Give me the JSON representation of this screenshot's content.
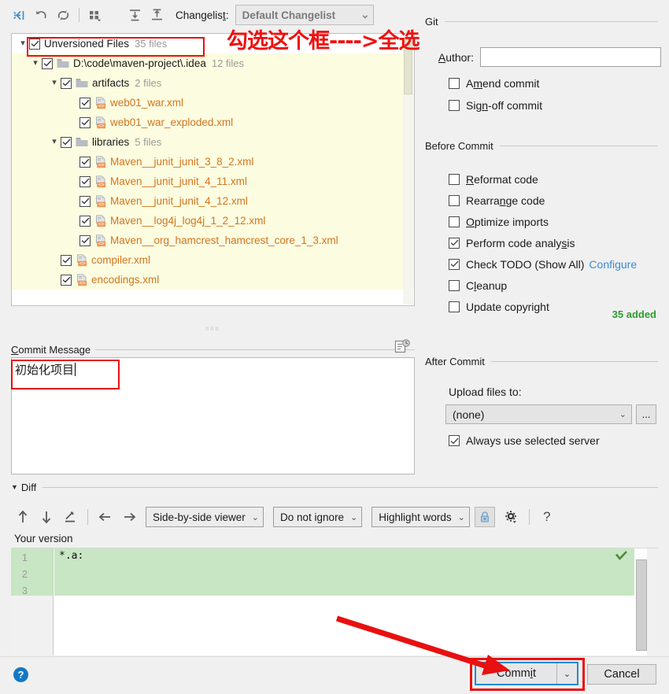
{
  "toolbar": {
    "icons": [
      {
        "name": "shelve-silently-icon",
        "glyph": "⇥"
      },
      {
        "name": "rollback-icon",
        "glyph": "↺"
      },
      {
        "name": "refresh-icon",
        "glyph": "⟳"
      },
      {
        "name": "group-by-icon",
        "glyph": "▦"
      },
      {
        "name": "expand-all-icon",
        "glyph": "⤒"
      },
      {
        "name": "collapse-all-icon",
        "glyph": "⤓"
      }
    ],
    "changelist_label": "Changelist:",
    "changelist_label_mnemonic": "t",
    "changelist_value": "Default Changelist",
    "chevron": "⌄"
  },
  "annotations": {
    "red_text": "勾选这个框---->全选",
    "boxes": [
      "unversioned-files-row",
      "commit-message-text",
      "commit-button"
    ],
    "arrow_color": "#e81010"
  },
  "tree": {
    "root": {
      "label": "Unversioned Files",
      "count": "35 files",
      "checked": true,
      "expanded": true
    },
    "nodes": [
      {
        "depth": 1,
        "type": "folder",
        "label": "D:\\code\\maven-project\\.idea",
        "count": "12 files",
        "checked": true,
        "expanded": true
      },
      {
        "depth": 2,
        "type": "folder",
        "label": "artifacts",
        "count": "2 files",
        "checked": true,
        "expanded": true
      },
      {
        "depth": 3,
        "type": "xml",
        "label": "web01_war.xml",
        "count": "",
        "checked": true
      },
      {
        "depth": 3,
        "type": "xml",
        "label": "web01_war_exploded.xml",
        "count": "",
        "checked": true
      },
      {
        "depth": 2,
        "type": "folder",
        "label": "libraries",
        "count": "5 files",
        "checked": true,
        "expanded": true
      },
      {
        "depth": 3,
        "type": "xml",
        "label": "Maven__junit_junit_3_8_2.xml",
        "count": "",
        "checked": true
      },
      {
        "depth": 3,
        "type": "xml",
        "label": "Maven__junit_junit_4_11.xml",
        "count": "",
        "checked": true
      },
      {
        "depth": 3,
        "type": "xml",
        "label": "Maven__junit_junit_4_12.xml",
        "count": "",
        "checked": true
      },
      {
        "depth": 3,
        "type": "xml",
        "label": "Maven__log4j_log4j_1_2_12.xml",
        "count": "",
        "checked": true
      },
      {
        "depth": 3,
        "type": "xml",
        "label": "Maven__org_hamcrest_hamcrest_core_1_3.xml",
        "count": "",
        "checked": true
      },
      {
        "depth": 2,
        "type": "xml",
        "label": "compiler.xml",
        "count": "",
        "checked": true
      },
      {
        "depth": 2,
        "type": "xml",
        "label": "encodings.xml",
        "count": "",
        "checked": true
      }
    ],
    "added_status": "35 added"
  },
  "commit_message": {
    "title": "Commit Message",
    "title_mnemonic": "C",
    "value": "初始化项目",
    "history_icon": "history-icon"
  },
  "git_group": {
    "title": "Git",
    "author_label": "Author:",
    "author_mnemonic": "A",
    "author_value": "",
    "checkboxes": [
      {
        "label_pre": "A",
        "label_mn": "m",
        "label_post": "end commit",
        "label": "Amend commit",
        "checked": false,
        "name": "amend-commit"
      },
      {
        "label_pre": "Sig",
        "label_mn": "n",
        "label_post": "-off commit",
        "label": "Sign-off commit",
        "checked": false,
        "name": "sign-off-commit"
      }
    ]
  },
  "before_commit": {
    "title": "Before Commit",
    "checkboxes": [
      {
        "label_pre": "",
        "label_mn": "R",
        "label_post": "eformat code",
        "label": "Reformat code",
        "checked": false,
        "name": "reformat-code"
      },
      {
        "label_pre": "Rearra",
        "label_mn": "n",
        "label_post": "ge code",
        "label": "Rearrange code",
        "checked": false,
        "name": "rearrange-code"
      },
      {
        "label_pre": "",
        "label_mn": "O",
        "label_post": "ptimize imports",
        "label": "Optimize imports",
        "checked": false,
        "name": "optimize-imports"
      },
      {
        "label_pre": "Perform code analy",
        "label_mn": "s",
        "label_post": "is",
        "label": "Perform code analysis",
        "checked": true,
        "name": "perform-code-analysis"
      },
      {
        "label_pre": "Check TODO (Show All)",
        "label_mn": "",
        "label_post": "",
        "label": "Check TODO (Show All)",
        "checked": true,
        "name": "check-todo",
        "link": "Configure"
      },
      {
        "label_pre": "C",
        "label_mn": "l",
        "label_post": "eanup",
        "label": "Cleanup",
        "checked": false,
        "name": "cleanup"
      },
      {
        "label_pre": "Update copyright",
        "label_mn": "",
        "label_post": "",
        "label": "Update copyright",
        "checked": false,
        "name": "update-copyright"
      }
    ]
  },
  "after_commit": {
    "title": "After Commit",
    "upload_label": "Upload files to:",
    "upload_value": "(none)",
    "upload_chevron": "⌄",
    "browse_label": "...",
    "always_use_label": "Always use selected server",
    "always_use_checked": true
  },
  "diff": {
    "title": "Diff",
    "twisty": "▼",
    "toolbar": {
      "prev_diff": "↑",
      "next_diff": "↓",
      "edit": "edit-pencil-icon",
      "left_arrow": "←",
      "right_arrow": "→",
      "viewer_mode": "Side-by-side viewer",
      "ignore_mode": "Do not ignore",
      "highlight_mode": "Highlight words",
      "lock_icon": "lock-icon",
      "settings_icon": "gear-icon",
      "help_icon": "?",
      "chevron": "⌄"
    },
    "pane_title": "Your version",
    "line_numbers": [
      "1",
      "2",
      "3"
    ],
    "code_lines": [
      "*.a:"
    ],
    "ok_marker": "check-icon"
  },
  "footer": {
    "help": "?",
    "commit_label_pre": "Comm",
    "commit_label_mn": "i",
    "commit_label_post": "t",
    "commit_label": "Commit",
    "commit_chevron": "⌄",
    "cancel_label": "Cancel"
  },
  "colors": {
    "accent_blue": "#1d8ad6",
    "annotation_red": "#e81010",
    "xml_file_text": "#d1761f",
    "tree_row_bg": "#fcfce0",
    "added_green": "#2e9b2e",
    "diff_green": "#c8e6c3",
    "link_blue": "#3d8bd4"
  }
}
